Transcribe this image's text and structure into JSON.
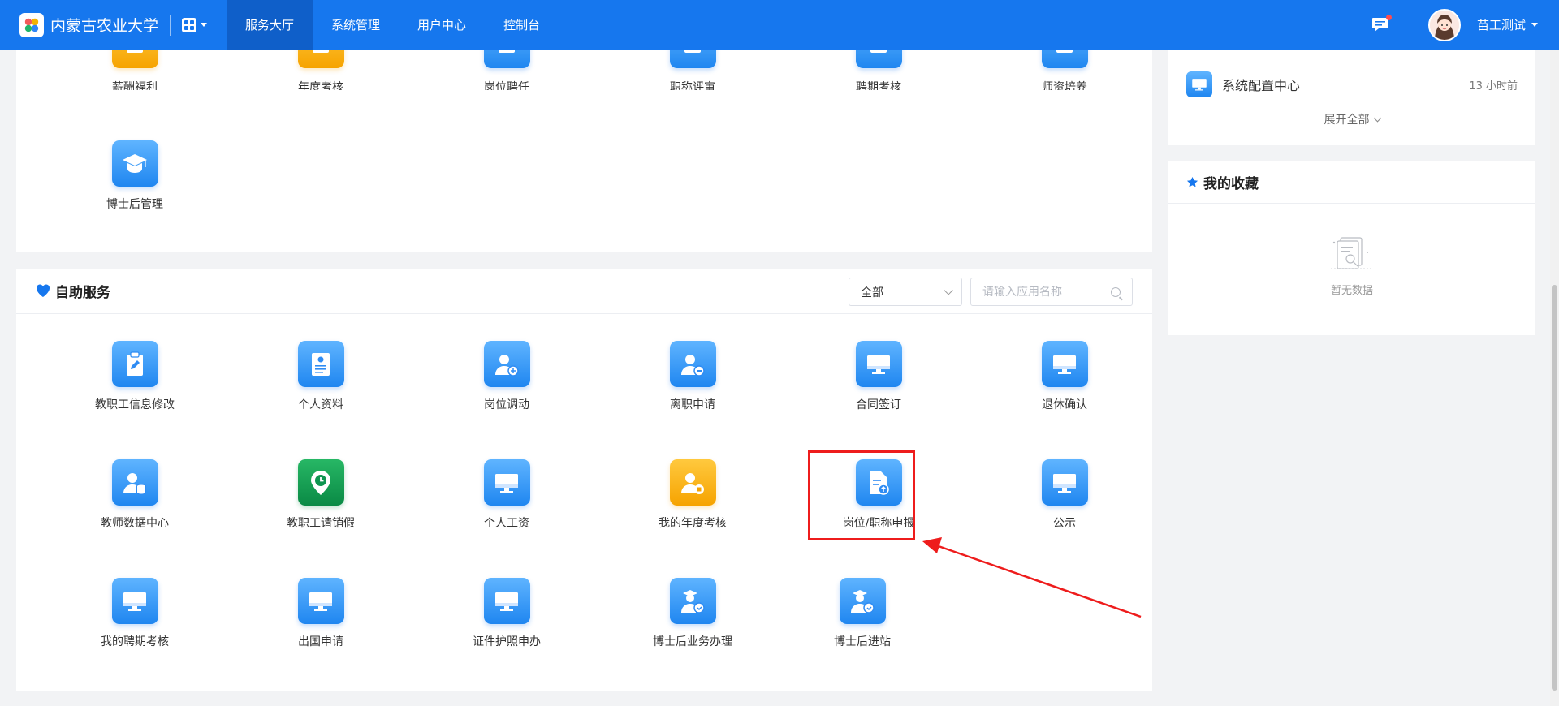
{
  "header": {
    "school_name": "内蒙古农业大学",
    "nav": [
      {
        "label": "服务大厅",
        "active": true
      },
      {
        "label": "系统管理",
        "active": false
      },
      {
        "label": "用户中心",
        "active": false
      },
      {
        "label": "控制台",
        "active": false
      }
    ],
    "username": "苗工测试",
    "message_icon": "chat-bubble-icon",
    "has_unread_dot": true
  },
  "top_panel": {
    "partial_row": [
      {
        "label": "薪酬福利",
        "icon": "benefits-icon",
        "color": "orange"
      },
      {
        "label": "年度考核",
        "icon": "annual-review-icon",
        "color": "orange"
      },
      {
        "label": "岗位聘任",
        "icon": "job-appointment-icon",
        "color": "blue"
      },
      {
        "label": "职称评审",
        "icon": "title-review-icon",
        "color": "blue"
      },
      {
        "label": "聘期考核",
        "icon": "term-assessment-icon",
        "color": "blue"
      },
      {
        "label": "师资培养",
        "icon": "teacher-training-icon",
        "color": "blue"
      }
    ],
    "row": [
      {
        "label": "博士后管理",
        "icon": "graduation-cap-icon",
        "color": "blue"
      }
    ]
  },
  "self_service": {
    "title": "自助服务",
    "title_icon": "heart-icon",
    "filter_value": "全部",
    "search_placeholder": "请输入应用名称",
    "apps": [
      {
        "label": "教职工信息修改",
        "icon": "clipboard-edit-icon",
        "color": "blue"
      },
      {
        "label": "个人资料",
        "icon": "profile-card-icon",
        "color": "blue"
      },
      {
        "label": "岗位调动",
        "icon": "user-transfer-icon",
        "color": "blue"
      },
      {
        "label": "离职申请",
        "icon": "user-remove-icon",
        "color": "blue"
      },
      {
        "label": "合同签订",
        "icon": "monitor-icon",
        "color": "blue"
      },
      {
        "label": "退休确认",
        "icon": "monitor-icon",
        "color": "blue"
      },
      {
        "label": "教师数据中心",
        "icon": "user-database-icon",
        "color": "blue"
      },
      {
        "label": "教职工请销假",
        "icon": "location-clock-icon",
        "color": "green"
      },
      {
        "label": "个人工资",
        "icon": "monitor-icon",
        "color": "blue"
      },
      {
        "label": "我的年度考核",
        "icon": "user-annual-icon",
        "color": "orange"
      },
      {
        "label": "岗位/职称申报",
        "icon": "document-upload-icon",
        "color": "blue",
        "highlighted": true
      },
      {
        "label": "公示",
        "icon": "monitor-icon",
        "color": "blue"
      },
      {
        "label": "我的聘期考核",
        "icon": "monitor-icon",
        "color": "blue"
      },
      {
        "label": "出国申请",
        "icon": "monitor-icon",
        "color": "blue"
      },
      {
        "label": "证件护照申办",
        "icon": "monitor-icon",
        "color": "blue"
      },
      {
        "label": "博士后业务办理",
        "icon": "postdoc-user-icon",
        "color": "blue"
      },
      {
        "label": "博士后进站",
        "icon": "postdoc-user-icon",
        "color": "blue"
      }
    ]
  },
  "notices": {
    "items": [
      {
        "title": "系统配置中心",
        "time": "13 小时前",
        "icon": "monitor-icon"
      }
    ],
    "expand_label": "展开全部"
  },
  "favorites": {
    "title": "我的收藏",
    "title_icon": "star-icon",
    "empty_text": "暂无数据",
    "empty_icon": "empty-document-icon"
  },
  "annotation": {
    "highlight_color": "#ee1c1c",
    "arrow_color": "#ee1c1c"
  },
  "colors": {
    "nav_blue": "#1677ee",
    "nav_active": "#0f5fc9"
  }
}
